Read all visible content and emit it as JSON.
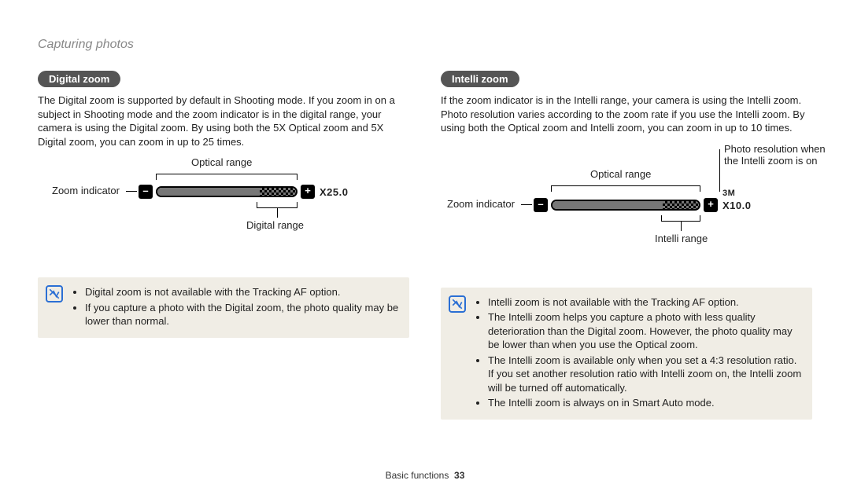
{
  "header": "Capturing photos",
  "left": {
    "tag": "Digital zoom",
    "paragraph": "The Digital zoom is supported by default in Shooting mode. If you zoom in on a subject in Shooting mode and the zoom indicator is in the digital range, your camera is using the Digital zoom. By using both the 5X Optical zoom and 5X Digital zoom, you can zoom in up to 25 times.",
    "diagram": {
      "optical": "Optical range",
      "zoom_indicator": "Zoom indicator",
      "below": "Digital range",
      "value": "X25.0"
    },
    "notes": [
      "Digital zoom is not available with the Tracking AF option.",
      "If you capture a photo with the Digital zoom, the photo quality may be lower than normal."
    ]
  },
  "right": {
    "tag": "Intelli zoom",
    "paragraph": "If the zoom indicator is in the Intelli range, your camera is using the Intelli zoom. Photo resolution varies according to the zoom rate if you use the Intelli zoom. By using both the Optical zoom and Intelli zoom, you can zoom in up to 10 times.",
    "diagram": {
      "optical": "Optical range",
      "zoom_indicator": "Zoom indicator",
      "below": "Intelli range",
      "res_label": "Photo resolution when the Intelli zoom is on",
      "res_value": "3M",
      "value": "X10.0"
    },
    "notes": [
      "Intelli zoom is not available with the Tracking AF option.",
      "The Intelli zoom helps you capture a photo with less quality deterioration than the Digital zoom. However, the photo quality may be lower than when you use the Optical zoom.",
      "The Intelli zoom is available only when you set a 4:3 resolution ratio. If you set another resolution ratio with Intelli zoom on, the Intelli zoom will be turned off automatically.",
      "The Intelli zoom is always on in Smart Auto mode."
    ]
  },
  "footer": {
    "section": "Basic functions",
    "page": "33"
  }
}
